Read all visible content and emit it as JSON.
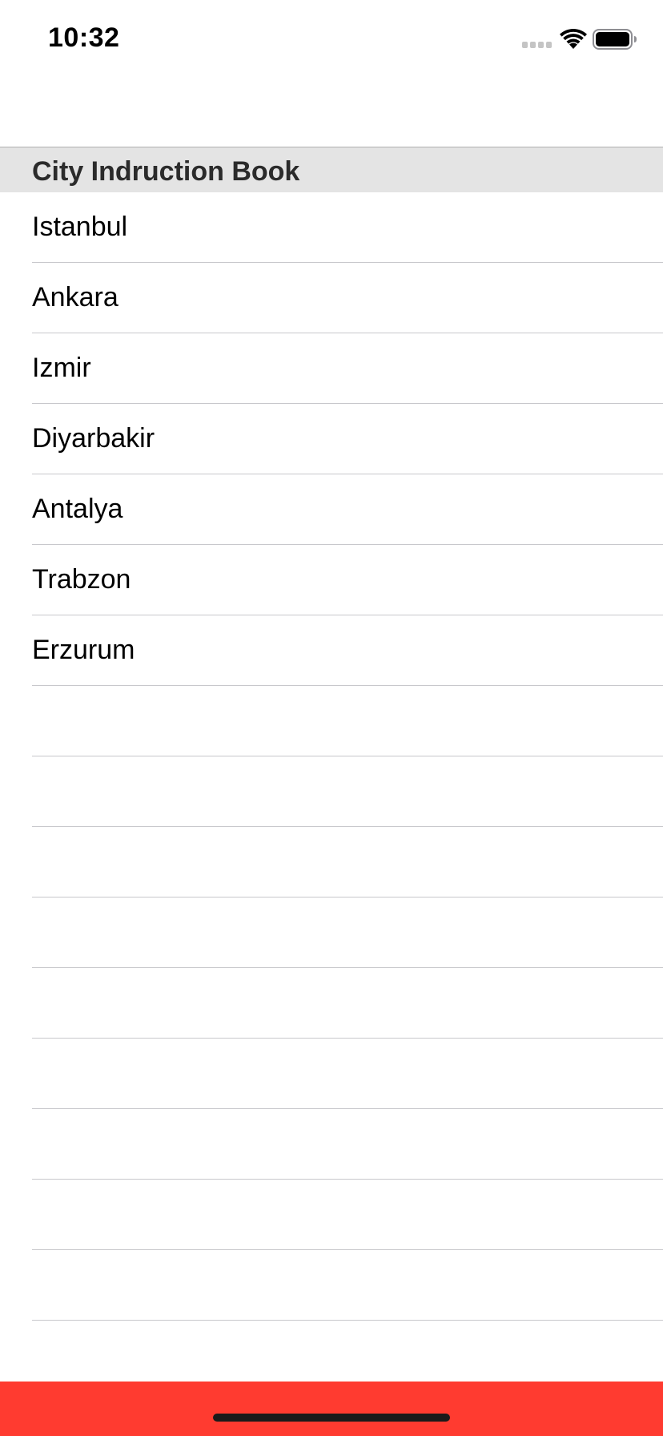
{
  "status_bar": {
    "time": "10:32",
    "icons": [
      "signal-dots-icon",
      "wifi-icon",
      "battery-icon"
    ]
  },
  "section": {
    "title": "City Indruction Book"
  },
  "cities": [
    "Istanbul",
    "Ankara",
    "Izmir",
    "Diyarbakir",
    "Antalya",
    "Trabzon",
    "Erzurum"
  ],
  "colors": {
    "bottom_bar": "#ff3b30",
    "section_header_bg": "#e4e4e4",
    "separator": "#c8c8cc"
  }
}
